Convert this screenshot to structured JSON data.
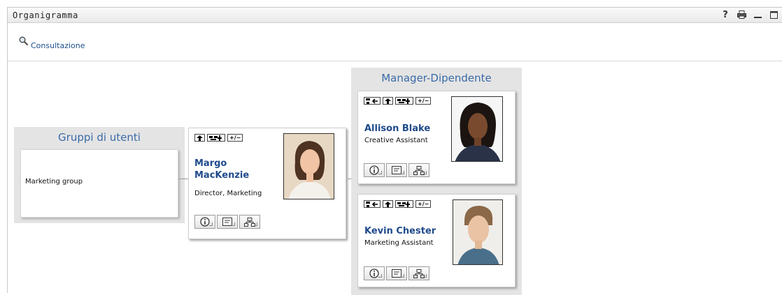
{
  "window": {
    "title": "Organigramma",
    "controls": [
      "help-icon",
      "print-icon",
      "minimize-icon",
      "maximize-icon"
    ]
  },
  "toolbar": {
    "lookup_label": "Consultazione",
    "lookup_icon": "magnifier-icon"
  },
  "groups_panel": {
    "title": "Gruppi di utenti",
    "group_name": "Marketing group"
  },
  "manager_panel": {
    "title": "Manager-Dipendente"
  },
  "cards": {
    "margo": {
      "name_first": "Margo",
      "name_last": "MacKenzie",
      "role": "Director, Marketing",
      "nav_buttons": [
        "up-arrow-icon",
        "expand-org-icon",
        "plus-minus-icon"
      ]
    },
    "allison": {
      "name": "Allison Blake",
      "role": "Creative Assistant",
      "nav_buttons": [
        "back-to-root-icon",
        "up-arrow-icon",
        "expand-org-icon",
        "plus-minus-icon"
      ]
    },
    "kevin": {
      "name": "Kevin Chester",
      "role": "Marketing Assistant",
      "nav_buttons": [
        "back-to-root-icon",
        "up-arrow-icon",
        "expand-org-icon",
        "plus-minus-icon"
      ]
    }
  },
  "mini_labels": {
    "plus_minus": "+/−"
  },
  "colors": {
    "link_blue": "#1f4a8c",
    "panel_title_blue": "#3a6ba8",
    "panel_bg": "#e4e4e4"
  }
}
